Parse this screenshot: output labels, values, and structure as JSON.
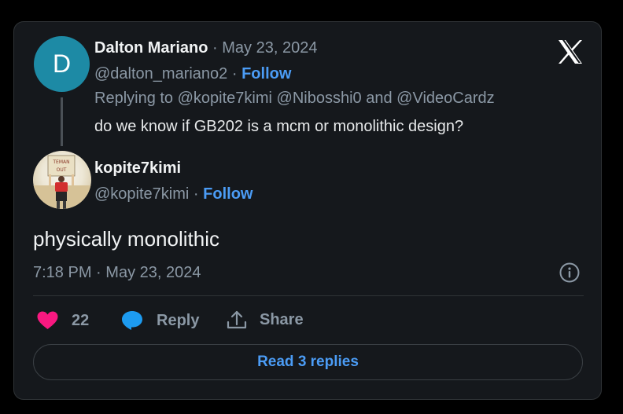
{
  "quoted": {
    "avatar_letter": "D",
    "name": "Dalton Mariano",
    "date": "May 23, 2024",
    "handle": "@dalton_mariano2",
    "follow_label": "Follow",
    "replying_prefix": "Replying to",
    "mention_1": "@kopite7kimi",
    "mention_2": "@Nibosshi0",
    "and_word": "and",
    "mention_3": "@VideoCardz",
    "text": "do we know if GB202 is a mcm or monolithic design?"
  },
  "reply": {
    "avatar_sign_line_1": "TEMAN",
    "avatar_sign_line_2": "OUT",
    "name": "kopite7kimi",
    "handle": "@kopite7kimi",
    "follow_label": "Follow",
    "text": "physically monolithic",
    "time": "7:18 PM",
    "date": "May 23, 2024"
  },
  "separator": "·",
  "actions": {
    "like_count": "22",
    "reply_label": "Reply",
    "share_label": "Share"
  },
  "read_replies_label": "Read 3 replies",
  "colors": {
    "background": "#000000",
    "card": "#15181c",
    "border": "#2f3336",
    "accent": "#4b9cf5",
    "like": "#f91880",
    "avatar_d": "#1d8aa5"
  },
  "icons": [
    "x-logo-icon",
    "info-icon",
    "heart-icon",
    "reply-bubble-icon",
    "share-icon"
  ]
}
